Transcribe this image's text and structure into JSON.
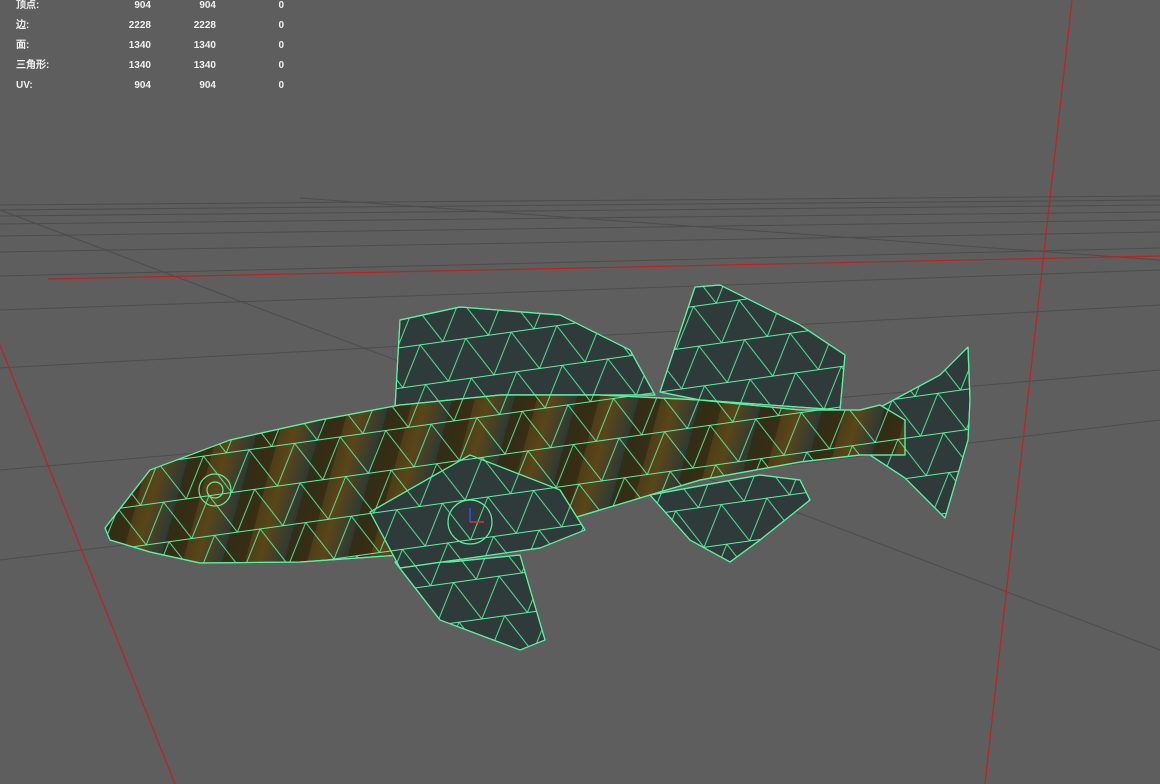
{
  "hud": {
    "rows": [
      {
        "label": "顶点:",
        "values": [
          "904",
          "904",
          "0"
        ]
      },
      {
        "label": "边:",
        "values": [
          "2228",
          "2228",
          "0"
        ]
      },
      {
        "label": "面:",
        "values": [
          "1340",
          "1340",
          "0"
        ]
      },
      {
        "label": "三角形:",
        "values": [
          "1340",
          "1340",
          "0"
        ]
      },
      {
        "label": "UV:",
        "values": [
          "904",
          "904",
          "0"
        ]
      }
    ]
  },
  "colors": {
    "background": "#5e5e5e",
    "grid": "#4a4a4a",
    "axis": "#c02020",
    "wireframe": "#5cf0a0"
  }
}
